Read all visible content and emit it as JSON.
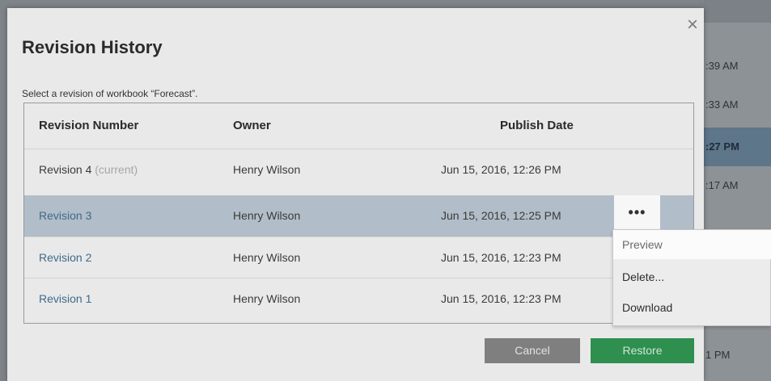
{
  "background_list": {
    "times": [
      ":39 AM",
      ":33 AM",
      ":27 PM",
      ":17 AM",
      "1 PM"
    ]
  },
  "dialog": {
    "title": "Revision History",
    "subtitle": "Select a revision of workbook “Forecast”.",
    "close_glyph": "×",
    "columns": {
      "revision": "Revision Number",
      "owner": "Owner",
      "date": "Publish Date"
    },
    "rows": [
      {
        "revision": "Revision 4",
        "tag": "(current)",
        "owner": "Henry Wilson",
        "date": "Jun 15, 2016, 12:26 PM"
      },
      {
        "revision": "Revision 3",
        "owner": "Henry Wilson",
        "date": "Jun 15, 2016, 12:25 PM"
      },
      {
        "revision": "Revision 2",
        "owner": "Henry Wilson",
        "date": "Jun 15, 2016, 12:23 PM"
      },
      {
        "revision": "Revision 1",
        "owner": "Henry Wilson",
        "date": "Jun 15, 2016, 12:23 PM"
      }
    ],
    "more_label": "•••",
    "cancel_label": "Cancel",
    "restore_label": "Restore"
  },
  "context_menu": {
    "items": [
      "Preview",
      "Delete...",
      "Download"
    ]
  },
  "colors": {
    "selected_row": "#b1bdc8",
    "restore_button": "#2e8f4f",
    "link_text": "#3f6a8a"
  }
}
